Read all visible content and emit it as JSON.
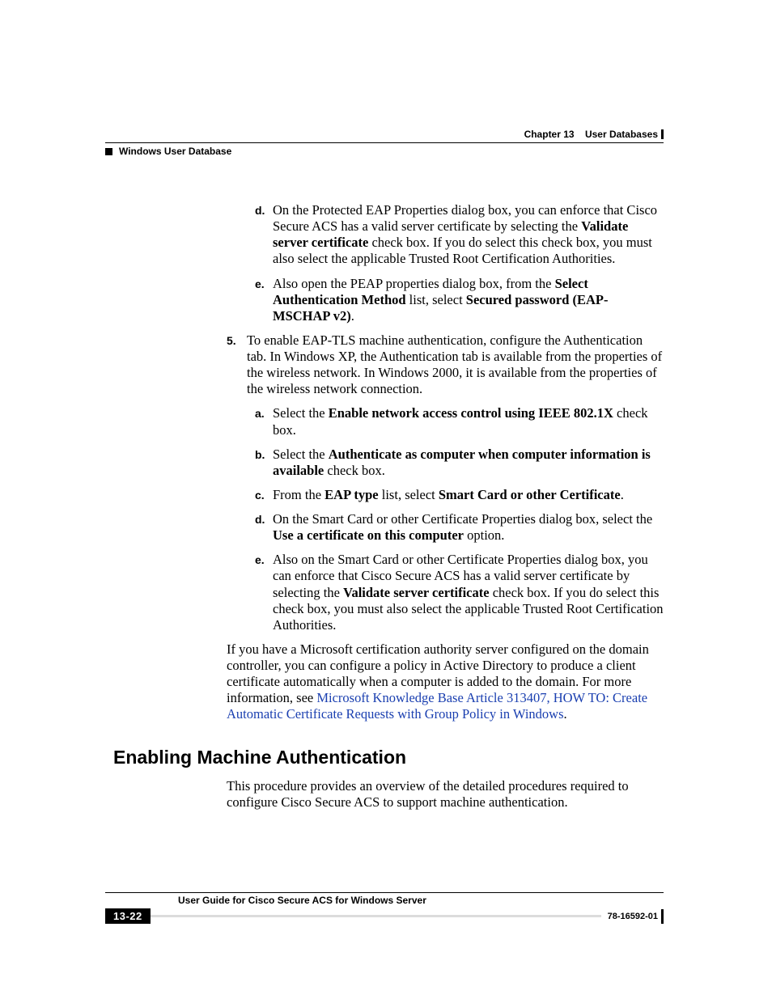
{
  "header": {
    "chapter_num": "Chapter 13",
    "chapter_title": "User Databases",
    "section": "Windows User Database"
  },
  "body": {
    "d": {
      "marker": "d.",
      "t1": "On the Protected EAP Properties dialog box, you can enforce that Cisco Secure ACS has a valid server certificate by selecting the ",
      "b1": "Validate server certificate",
      "t2": " check box. If you do select this check box, you must also select the applicable Trusted Root Certification Authorities."
    },
    "e": {
      "marker": "e.",
      "t1": "Also open the PEAP properties dialog box, from the ",
      "b1": "Select Authentication Method",
      "t2": " list, select ",
      "b2": "Secured password (EAP-MSCHAP v2)",
      "t3": "."
    },
    "s5": {
      "marker": "5.",
      "text": "To enable EAP-TLS machine authentication, configure the Authentication tab. In Windows XP, the Authentication tab is available from the properties of the wireless network. In Windows 2000, it is available from the properties of the wireless network connection."
    },
    "s5a": {
      "marker": "a.",
      "t1": "Select the ",
      "b1": "Enable network access control using IEEE 802.1X",
      "t2": " check box."
    },
    "s5b": {
      "marker": "b.",
      "t1": "Select the ",
      "b1": "Authenticate as computer when computer information is available",
      "t2": " check box."
    },
    "s5c": {
      "marker": "c.",
      "t1": "From the ",
      "b1": "EAP type",
      "t2": " list, select ",
      "b2": "Smart Card or other Certificate",
      "t3": "."
    },
    "s5d": {
      "marker": "d.",
      "t1": "On the Smart Card or other Certificate Properties dialog box, select the ",
      "b1": "Use a certificate on this computer",
      "t2": " option."
    },
    "s5e": {
      "marker": "e.",
      "t1": "Also on the Smart Card or other Certificate Properties dialog box, you can enforce that Cisco Secure ACS has a valid server certificate by selecting the ",
      "b1": "Validate server certificate",
      "t2": " check box. If you do select this check box, you must also select the applicable Trusted Root Certification Authorities."
    },
    "para_after": {
      "t1": "If you have a Microsoft certification authority server configured on the domain controller, you can configure a policy in Active Directory to produce a client certificate automatically when a computer is added to the domain. For more information, see ",
      "link": "Microsoft Knowledge Base Article 313407, HOW TO: Create Automatic Certificate Requests with Group Policy in Windows",
      "t2": "."
    },
    "h2": "Enabling Machine Authentication",
    "h2_body": "This procedure provides an overview of the detailed procedures required to configure Cisco Secure ACS to support machine authentication."
  },
  "footer": {
    "guide_title": "User Guide for Cisco Secure ACS for Windows Server",
    "page": "13-22",
    "docnum": "78-16592-01"
  }
}
